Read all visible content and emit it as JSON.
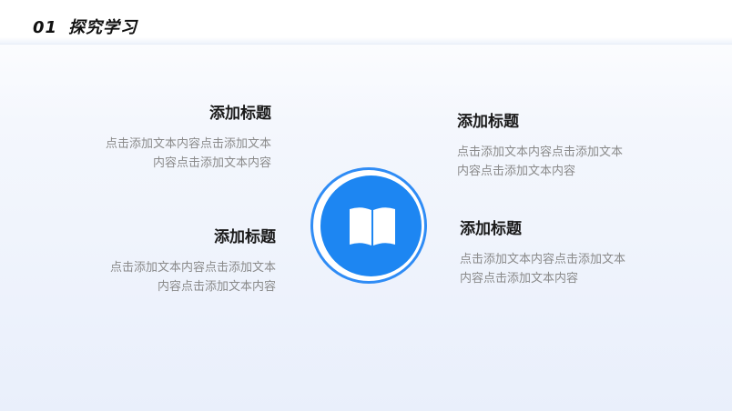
{
  "header": {
    "number": "01",
    "title": "探究学习"
  },
  "blocks": {
    "top_left": {
      "title": "添加标题",
      "line1": "点击添加文本内容点击添加文本",
      "line2": "内容点击添加文本内容"
    },
    "bottom_left": {
      "title": "添加标题",
      "line1": "点击添加文本内容点击添加文本",
      "line2": "内容点击添加文本内容"
    },
    "top_right": {
      "title": "添加标题",
      "line1": "点击添加文本内容点击添加文本",
      "line2": "内容点击添加文本内容"
    },
    "bottom_right": {
      "title": "添加标题",
      "line1": "点击添加文本内容点击添加文本",
      "line2": "内容点击添加文本内容"
    }
  },
  "center": {
    "icon": "book-icon"
  },
  "colors": {
    "accent": "#1d86f2",
    "ring": "#2f8cf5",
    "title_text": "#1a1a1a",
    "body_text": "#8a8a8a"
  }
}
